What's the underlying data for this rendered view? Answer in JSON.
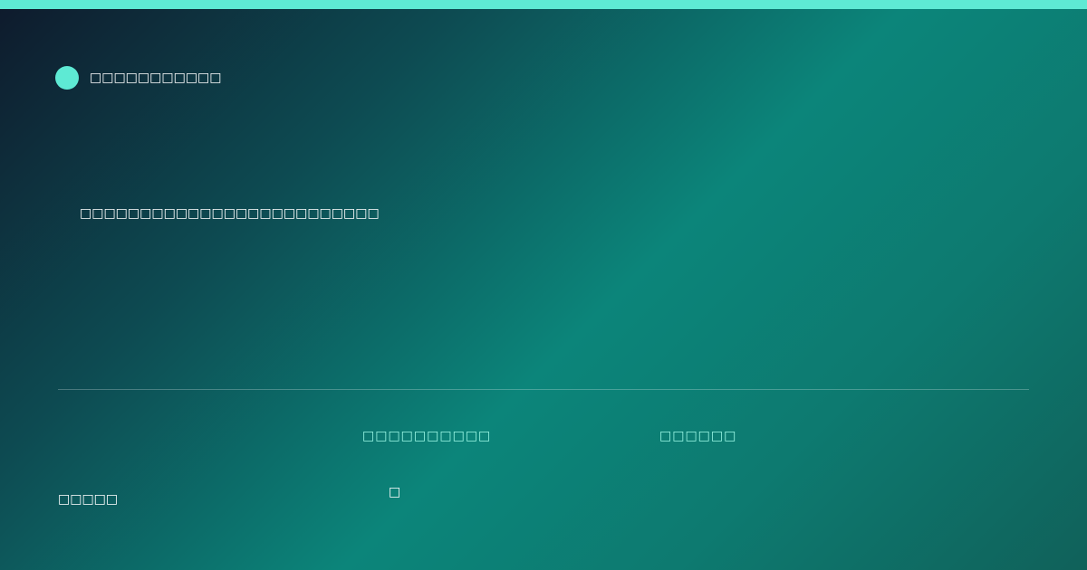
{
  "colors": {
    "accent": "#5eead4",
    "label": "#99f6e4",
    "text": "#ffffff"
  },
  "brand": {
    "logo_icon": "circle-logo-icon",
    "name": "□□□□□□□□□□□"
  },
  "headline": "□□□□□□□□□□□□□□□□□□□□□□□□□",
  "stats": [
    {
      "label": "□□□□□□□□□□",
      "value": "□"
    },
    {
      "label": "□□□□□□",
      "value": ""
    }
  ],
  "footer": {
    "label": "□□□□□"
  }
}
